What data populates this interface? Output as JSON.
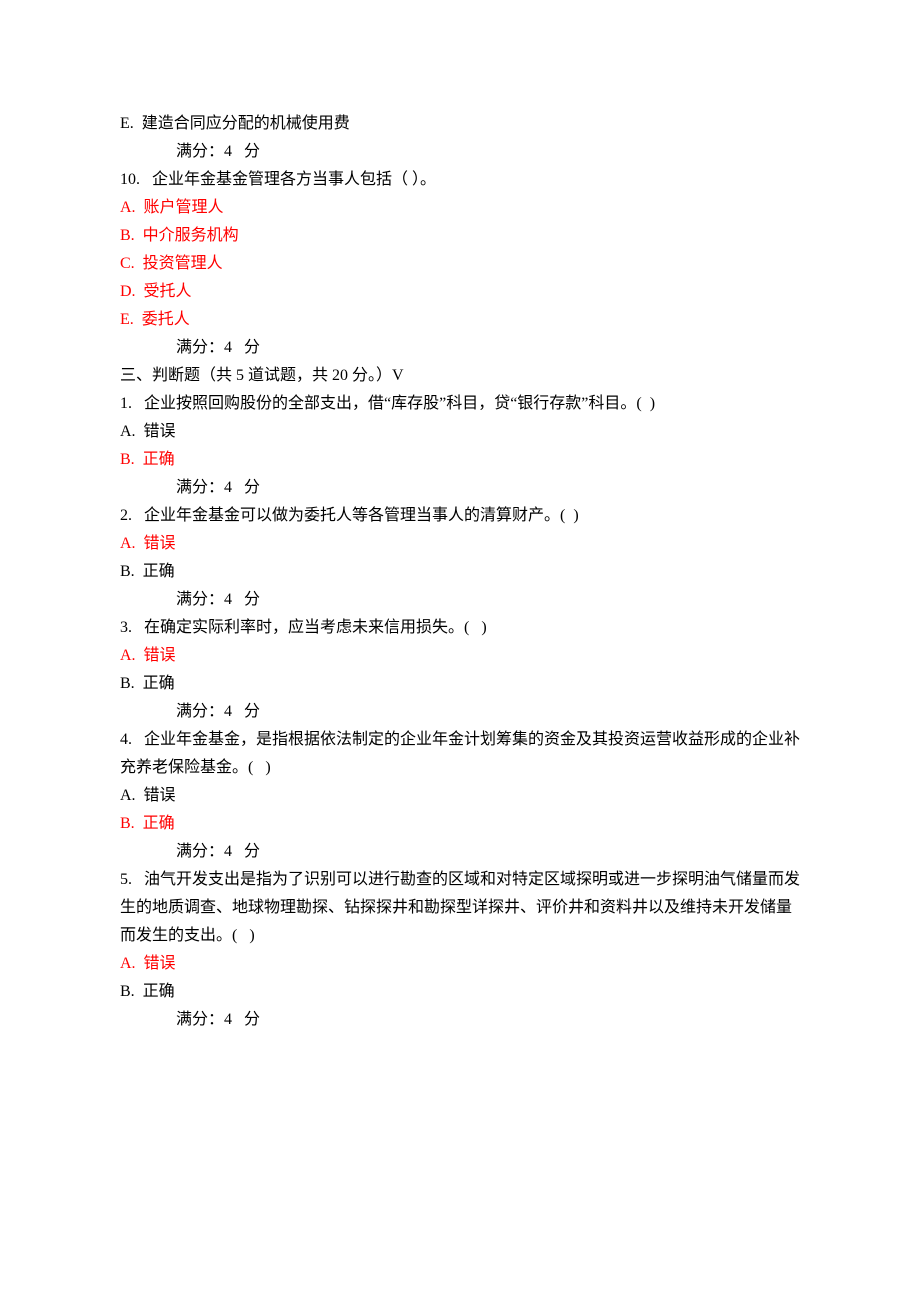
{
  "q_prev": {
    "optE": "E.  建造合同应分配的机械使用费",
    "score": "满分：4   分"
  },
  "q10": {
    "stem": "10.   企业年金基金管理各方当事人包括（ ）。",
    "optA": "A.  账户管理人",
    "optB": "B.  中介服务机构",
    "optC": "C.  投资管理人",
    "optD": "D.  受托人",
    "optE": "E.  委托人",
    "score": "满分：4   分"
  },
  "section3": {
    "heading": "三、判断题（共 5 道试题，共 20 分。）V"
  },
  "tf1": {
    "stem": "1.   企业按照回购股份的全部支出，借“库存股”科目，贷“银行存款”科目。(  )",
    "optA": "A.  错误",
    "optB": "B.  正确",
    "score": "满分：4   分"
  },
  "tf2": {
    "stem": "2.   企业年金基金可以做为委托人等各管理当事人的清算财产。(  )",
    "optA": "A.  错误",
    "optB": "B.  正确",
    "score": "满分：4   分"
  },
  "tf3": {
    "stem": "3.   在确定实际利率时，应当考虑未来信用损失。(   )",
    "optA": "A.  错误",
    "optB": "B.  正确",
    "score": "满分：4   分"
  },
  "tf4": {
    "stem": "4.   企业年金基金，是指根据依法制定的企业年金计划筹集的资金及其投资运营收益形成的企业补充养老保险基金。(   )",
    "optA": "A.  错误",
    "optB": "B.  正确",
    "score": "满分：4   分"
  },
  "tf5": {
    "stem": "5.   油气开发支出是指为了识别可以进行勘查的区域和对特定区域探明或进一步探明油气储量而发生的地质调查、地球物理勘探、钻探探井和勘探型详探井、评价井和资料井以及维持未开发储量而发生的支出。(   )",
    "optA": "A.  错误",
    "optB": "B.  正确",
    "score": "满分：4   分"
  }
}
